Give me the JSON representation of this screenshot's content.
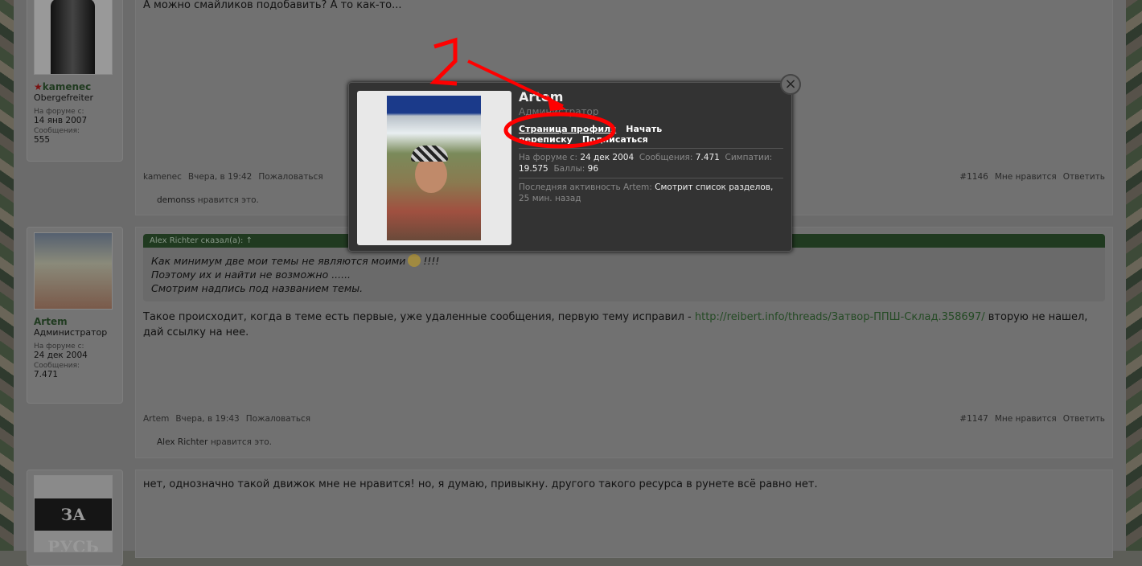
{
  "posts": [
    {
      "user": {
        "name": "kamenec",
        "title": "Obergefreiter",
        "joined_label": "На форуме с:",
        "joined": "14 янв 2007",
        "messages_label": "Сообщения:",
        "messages": "555"
      },
      "text": "А можно смайликов подобавить? А то как-то...",
      "meta": {
        "author": "kamenec",
        "time": "Вчера, в 19:42",
        "report": "Пожаловаться"
      },
      "actions": {
        "number": "#1146",
        "like": "Мне нравится",
        "reply": "Ответить"
      },
      "likes": {
        "user": "demonss",
        "suffix": "нравится это."
      }
    },
    {
      "user": {
        "name": "Artem",
        "title": "Администратор",
        "joined_label": "На форуме с:",
        "joined": "24 дек 2004",
        "messages_label": "Сообщения:",
        "messages": "7.471"
      },
      "quote": {
        "header": "Alex Richter сказал(а): ↑",
        "lines": [
          "Как минимум две мои темы не являются моими",
          "Поэтому их и найти не возможно ......",
          "Смотрим надпись под названием темы."
        ],
        "line1_suffix": "!!!!"
      },
      "text_before": "Такое происходит, когда в теме есть первые, уже удаленные сообщения, первую тему исправил - ",
      "link": "http://reibert.info/threads/Затвор-ППШ-Склад.358697/",
      "text_after": " вторую не нашел, дай ссылку на нее.",
      "meta": {
        "author": "Artem",
        "time": "Вчера, в 19:43",
        "report": "Пожаловаться"
      },
      "actions": {
        "number": "#1147",
        "like": "Мне нравится",
        "reply": "Ответить"
      },
      "likes": {
        "user": "Alex Richter",
        "suffix": "нравится это."
      }
    },
    {
      "user": {
        "avatar_text": "ЗА РУСЬ"
      },
      "text": "нет, однозначно такой движок мне не нравится! но, я думаю, привыкну. другого такого ресурса в рунете всё равно нет."
    }
  ],
  "popup": {
    "name": "Artem",
    "role": "Администратор",
    "links": [
      "Страница профиля",
      "Начать переписку",
      "Подписаться"
    ],
    "joined_label": "На форуме с:",
    "joined": "24 дек 2004",
    "messages_label": "Сообщения:",
    "messages": "7.471",
    "likes_label": "Симпатии:",
    "likes": "19.575",
    "points_label": "Баллы:",
    "points": "96",
    "activity_label": "Последняя активность Artem:",
    "activity": "Смотрит список разделов,",
    "activity_time": "25 мин. назад",
    "close": "×"
  },
  "annotation": {
    "number": "2",
    "color": "#ff0000"
  }
}
